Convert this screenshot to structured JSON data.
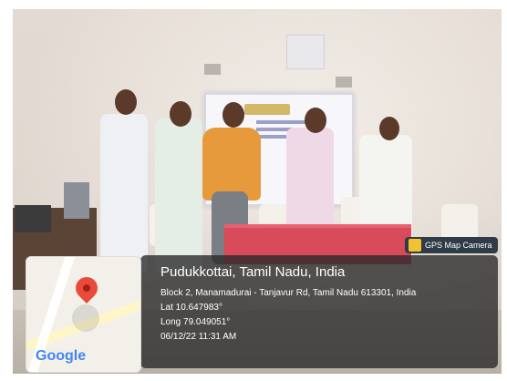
{
  "location": {
    "title": "Pudukkottai, Tamil Nadu, India",
    "address": "Block 2, Manamadurai - Tanjavur Rd, Tamil Nadu 613301, India",
    "lat": "Lat 10.647983°",
    "long": "Long 79.049051°",
    "datetime": "06/12/22 11:31 AM"
  },
  "badge": {
    "label": "GPS Map Camera",
    "icon": "map-camera-icon"
  },
  "map": {
    "brand": "Google",
    "pin_icon": "map-pin-icon",
    "colors": {
      "pin": "#e84a3c",
      "google_blue": "#4285f4"
    }
  }
}
